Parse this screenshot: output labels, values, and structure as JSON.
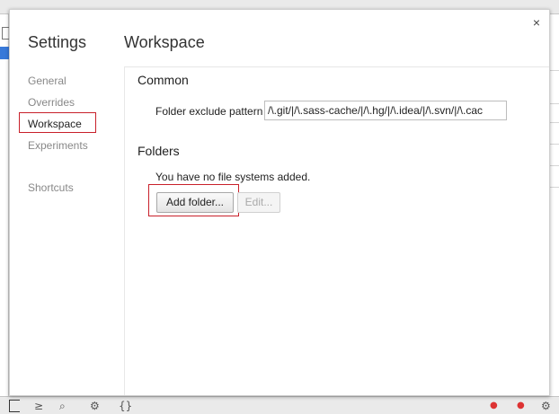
{
  "dialog": {
    "settings_title": "Settings",
    "close_label": "×",
    "nav": [
      {
        "label": "General"
      },
      {
        "label": "Overrides"
      },
      {
        "label": "Workspace"
      },
      {
        "label": "Experiments"
      },
      {
        "label": "Shortcuts"
      }
    ],
    "selected_nav": "Workspace",
    "workspace": {
      "title": "Workspace",
      "common": {
        "title": "Common",
        "exclude_label": "Folder exclude pattern",
        "exclude_value": "/\\.git/|/\\.sass-cache/|/\\.hg/|/\\.idea/|/\\.svn/|/\\.cac"
      },
      "folders": {
        "title": "Folders",
        "empty_message": "You have no file systems added.",
        "add_button": "Add folder...",
        "edit_button": "Edit..."
      }
    }
  },
  "colors": {
    "highlight": "#c8202a",
    "accent": "#3879d9"
  }
}
